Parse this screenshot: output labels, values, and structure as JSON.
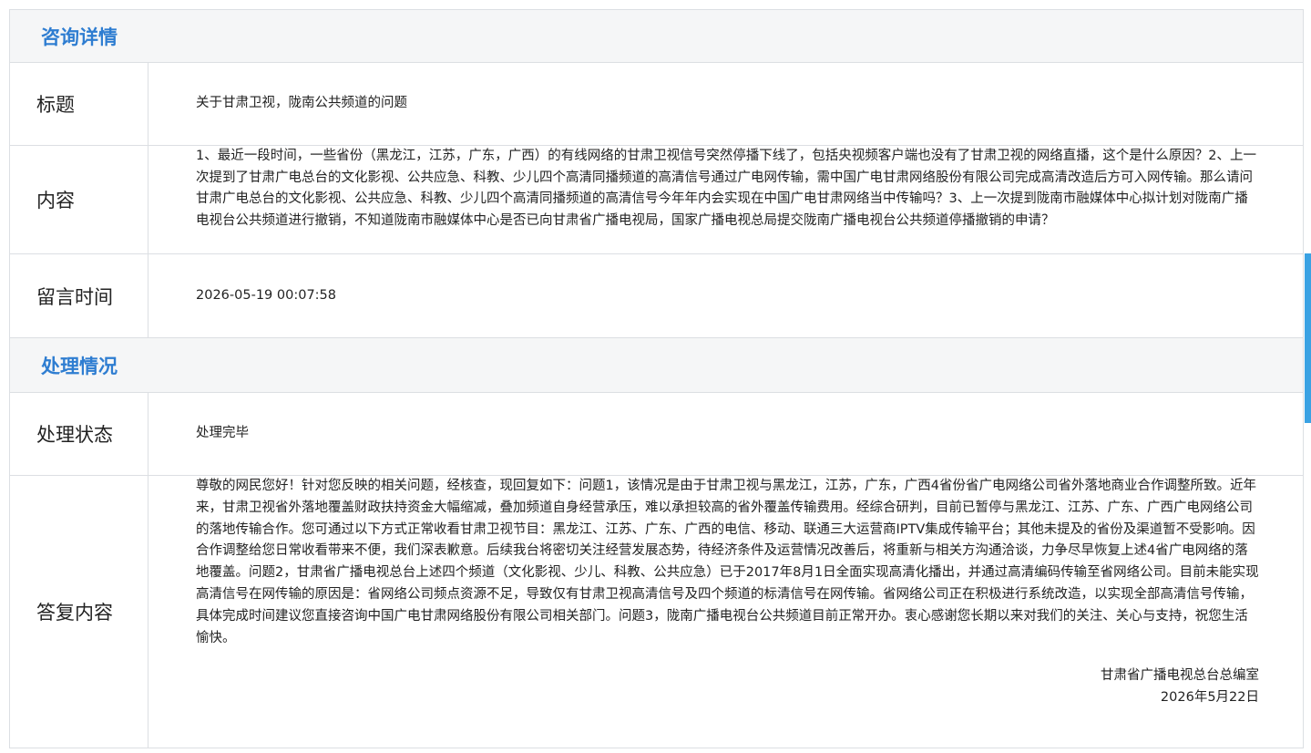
{
  "sections": {
    "inquiry_title": "咨询详情",
    "handling_title": "处理情况"
  },
  "inquiry": {
    "title_label": "标题",
    "title_value": "关于甘肃卫视，陇南公共频道的问题",
    "content_label": "内容",
    "content_value": "1、最近一段时间，一些省份（黑龙江，江苏，广东，广西）的有线网络的甘肃卫视信号突然停播下线了，包括央视频客户端也没有了甘肃卫视的网络直播，这个是什么原因？2、上一次提到了甘肃广电总台的文化影视、公共应急、科教、少儿四个高清同播频道的高清信号通过广电网传输，需中国广电甘肃网络股份有限公司完成高清改造后方可入网传输。那么请问甘肃广电总台的文化影视、公共应急、科教、少儿四个高清同播频道的高清信号今年年内会实现在中国广电甘肃网络当中传输吗？3、上一次提到陇南市融媒体中心拟计划对陇南广播电视台公共频道进行撤销，不知道陇南市融媒体中心是否已向甘肃省广播电视局，国家广播电视总局提交陇南广播电视台公共频道停播撤销的申请？",
    "time_label": "留言时间",
    "time_value": "2026-05-19 00:07:58"
  },
  "handling": {
    "status_label": "处理状态",
    "status_value": "处理完毕",
    "reply_label": "答复内容",
    "reply_value": "尊敬的网民您好！针对您反映的相关问题，经核查，现回复如下：问题1，该情况是由于甘肃卫视与黑龙江，江苏，广东，广西4省份省广电网络公司省外落地商业合作调整所致。近年来，甘肃卫视省外落地覆盖财政扶持资金大幅缩减，叠加频道自身经营承压，难以承担较高的省外覆盖传输费用。经综合研判，目前已暂停与黑龙江、江苏、广东、广西广电网络公司的落地传输合作。您可通过以下方式正常收看甘肃卫视节目：黑龙江、江苏、广东、广西的电信、移动、联通三大运营商IPTV集成传输平台；其他未提及的省份及渠道暂不受影响。因合作调整给您日常收看带来不便，我们深表歉意。后续我台将密切关注经营发展态势，待经济条件及运营情况改善后，将重新与相关方沟通洽谈，力争尽早恢复上述4省广电网络的落地覆盖。问题2，甘肃省广播电视总台上述四个频道（文化影视、少儿、科教、公共应急）已于2017年8月1日全面实现高清化播出，并通过高清编码传输至省网络公司。目前未能实现高清信号在网传输的原因是：省网络公司频点资源不足，导致仅有甘肃卫视高清信号及四个频道的标清信号在网传输。省网络公司正在积极进行系统改造，以实现全部高清信号传输，具体完成时间建议您直接咨询中国广电甘肃网络股份有限公司相关部门。问题3，陇南广播电视台公共频道目前正常开办。衷心感谢您长期以来对我们的关注、关心与支持，祝您生活愉快。",
    "reply_org": "甘肃省广播电视总台总编室",
    "reply_date": "2026年5月22日"
  },
  "colors": {
    "section_title": "#2e7dd1",
    "scroll_accent": "#3aa2e3"
  }
}
